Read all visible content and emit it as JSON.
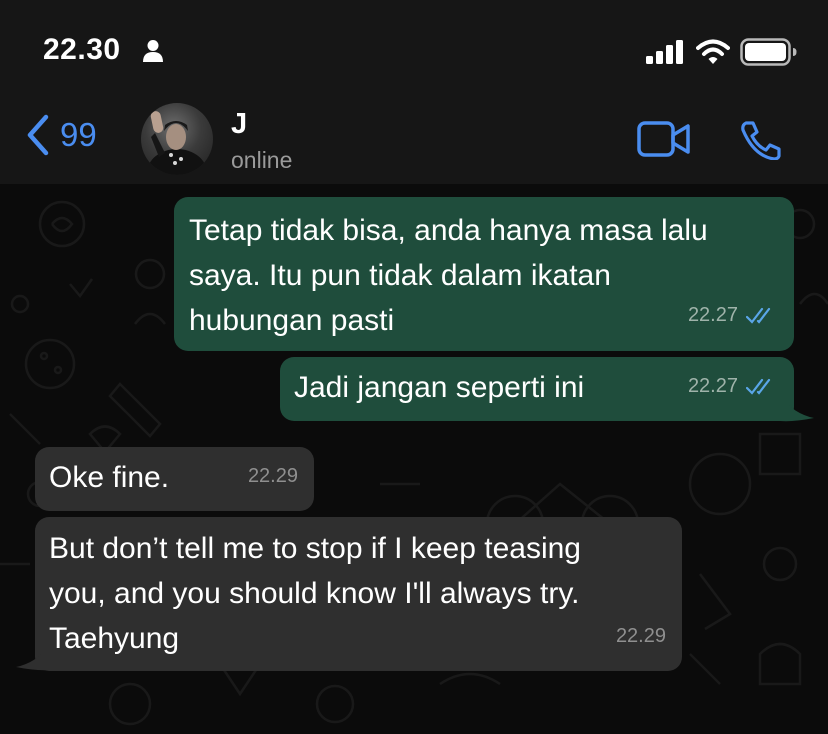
{
  "status_bar": {
    "time": "22.30"
  },
  "header": {
    "back_count": "99",
    "contact_name": "J",
    "contact_status": "online"
  },
  "messages": [
    {
      "direction": "outgoing",
      "text": "Tetap tidak bisa, anda hanya masa lalu\nsaya. Itu pun tidak dalam ikatan\nhubungan pasti",
      "time": "22.27",
      "read": true
    },
    {
      "direction": "outgoing",
      "text": "Jadi jangan seperti ini",
      "time": "22.27",
      "read": true
    },
    {
      "direction": "incoming",
      "text": "Oke fine.",
      "time": "22.29"
    },
    {
      "direction": "incoming",
      "text": "But don’t tell me to stop if I keep teasing\nyou, and you should know I'll always try.\nTaehyung",
      "time": "22.29"
    }
  ],
  "colors": {
    "accent": "#4a8df0",
    "outgoing_bubble": "#1f4d3c",
    "incoming_bubble": "#2f2f2f",
    "read_ticks": "#5aa6e8"
  },
  "icons": [
    "person-icon",
    "signal-icon",
    "wifi-icon",
    "battery-icon",
    "back-chevron-icon",
    "video-call-icon",
    "phone-icon",
    "double-check-icon"
  ]
}
